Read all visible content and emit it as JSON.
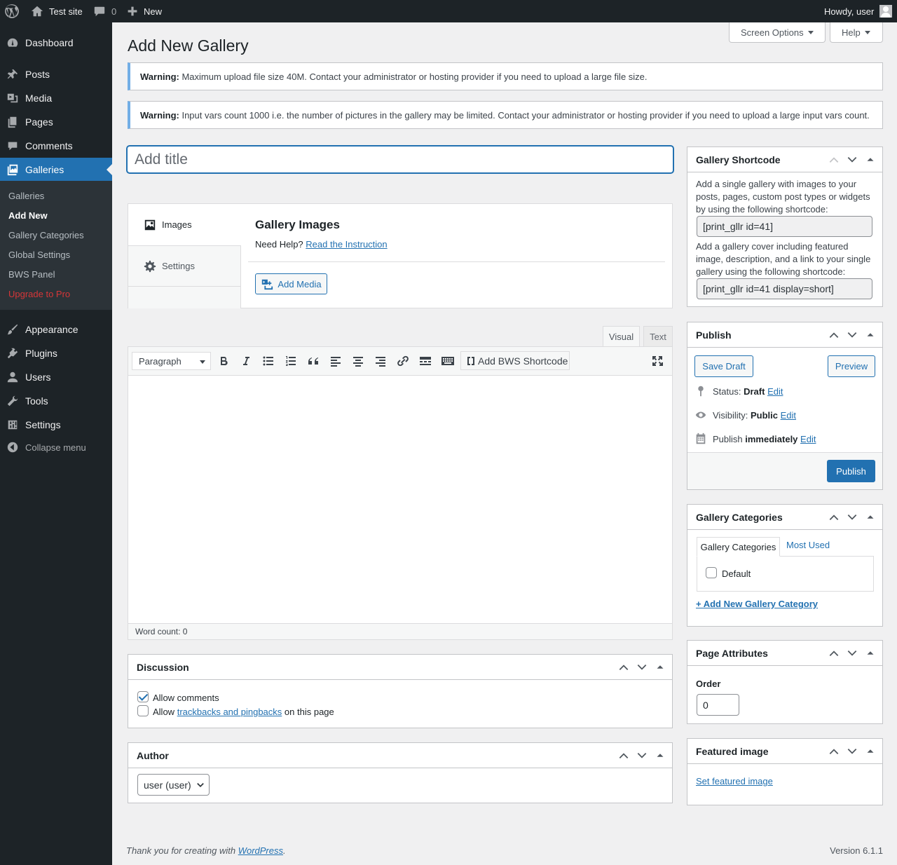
{
  "adminbar": {
    "site_name": "Test site",
    "comments_count": "0",
    "new_label": "New",
    "howdy": "Howdy, user"
  },
  "sidebar": {
    "items": [
      {
        "label": "Dashboard"
      },
      {
        "label": "Posts"
      },
      {
        "label": "Media"
      },
      {
        "label": "Pages"
      },
      {
        "label": "Comments"
      },
      {
        "label": "Galleries"
      },
      {
        "label": "Appearance"
      },
      {
        "label": "Plugins"
      },
      {
        "label": "Users"
      },
      {
        "label": "Tools"
      },
      {
        "label": "Settings"
      },
      {
        "label": "Collapse menu"
      }
    ],
    "submenu": [
      {
        "label": "Galleries"
      },
      {
        "label": "Add New"
      },
      {
        "label": "Gallery Categories"
      },
      {
        "label": "Global Settings"
      },
      {
        "label": "BWS Panel"
      },
      {
        "label": "Upgrade to Pro"
      }
    ]
  },
  "screen_options": "Screen Options",
  "help": "Help",
  "page_title": "Add New Gallery",
  "notices": [
    {
      "strong": "Warning:",
      "text": " Maximum upload file size 40M. Contact your administrator or hosting provider if you need to upload a large file size."
    },
    {
      "strong": "Warning:",
      "text": " Input vars count 1000 i.e. the number of pictures in the gallery may be limited. Contact your administrator or hosting provider if you need to upload a large input vars count."
    }
  ],
  "title_placeholder": "Add title",
  "gallery": {
    "tab_images": "Images",
    "tab_settings": "Settings",
    "heading": "Gallery Images",
    "need_help": "Need Help?",
    "instruction_link": "Read the Instruction",
    "add_media": "Add Media"
  },
  "editor": {
    "tab_visual": "Visual",
    "tab_text": "Text",
    "format_select": "Paragraph",
    "bws_shortcode": "Add BWS Shortcode",
    "word_count": "Word count: 0"
  },
  "discussion": {
    "title": "Discussion",
    "allow_comments": "Allow comments",
    "allow_prefix": "Allow",
    "trackbacks_link": "trackbacks and pingbacks",
    "allow_suffix": "on this page"
  },
  "author": {
    "title": "Author",
    "selected": "user (user)"
  },
  "shortcode_box": {
    "title": "Gallery Shortcode",
    "desc1": "Add a single gallery with images to your posts, pages, custom post types or widgets by using the following shortcode:",
    "code1": "[print_gllr id=41]",
    "desc2": "Add a gallery cover including featured image, description, and a link to your single gallery using the following shortcode:",
    "code2": "[print_gllr id=41 display=short]"
  },
  "publish": {
    "title": "Publish",
    "save_draft": "Save Draft",
    "preview": "Preview",
    "status_label": "Status:",
    "status_value": "Draft",
    "visibility_label": "Visibility:",
    "visibility_value": "Public",
    "publish_label": "Publish",
    "publish_value": "immediately",
    "edit": "Edit",
    "publish_button": "Publish"
  },
  "categories": {
    "title": "Gallery Categories",
    "tab_all": "Gallery Categories",
    "tab_used": "Most Used",
    "default_item": "Default",
    "add_new": "+ Add New Gallery Category"
  },
  "page_attributes": {
    "title": "Page Attributes",
    "order_label": "Order",
    "order_value": "0"
  },
  "featured": {
    "title": "Featured image",
    "set_link": "Set featured image"
  },
  "footer": {
    "thanks_prefix": "Thank you for creating with",
    "wp_link": "WordPress",
    "thanks_suffix": ".",
    "version": "Version 6.1.1"
  },
  "colors": {
    "accent": "#2271b1",
    "sidebar_bg": "#1d2327",
    "upgrade": "#d63638"
  }
}
